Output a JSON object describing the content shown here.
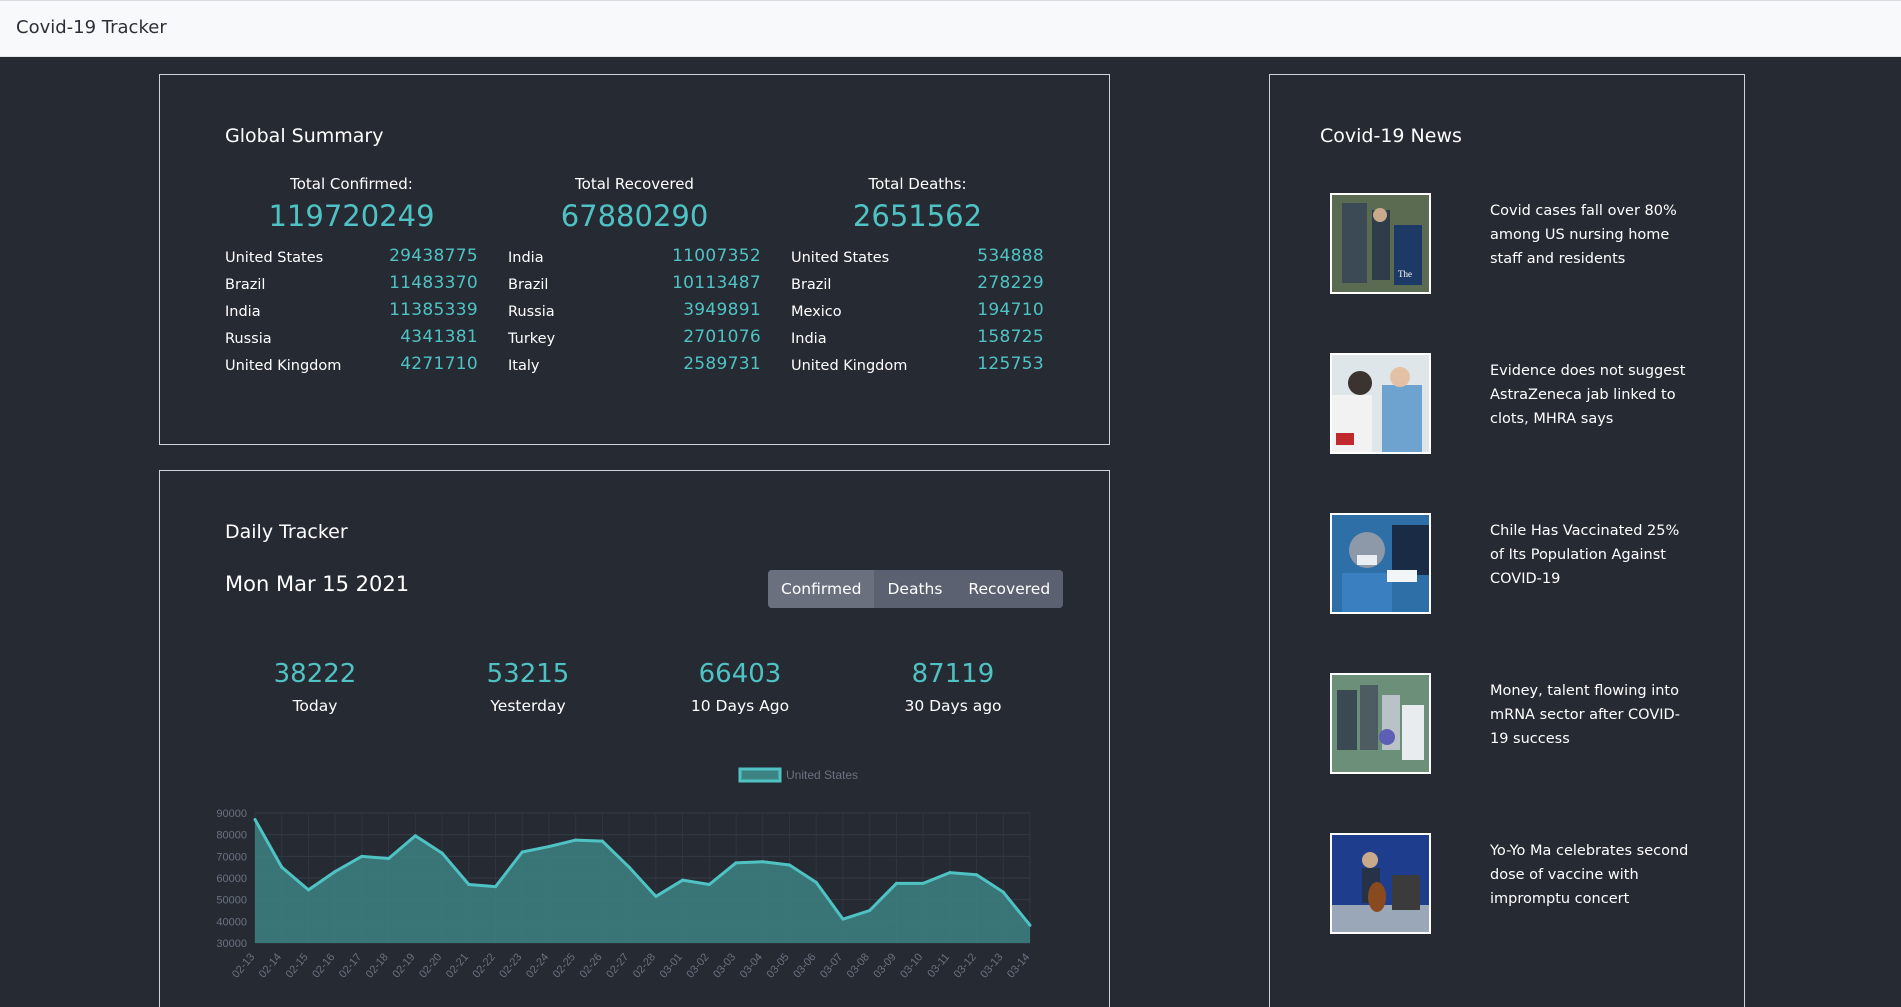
{
  "app": {
    "title": "Covid-19 Tracker"
  },
  "summary": {
    "title": "Global Summary",
    "columns": [
      {
        "heading": "Total Confirmed:",
        "total": "119720249",
        "rows": [
          {
            "name": "United States",
            "value": "29438775"
          },
          {
            "name": "Brazil",
            "value": "11483370"
          },
          {
            "name": "India",
            "value": "11385339"
          },
          {
            "name": "Russia",
            "value": "4341381"
          },
          {
            "name": "United Kingdom",
            "value": "4271710"
          }
        ]
      },
      {
        "heading": "Total Recovered",
        "total": "67880290",
        "rows": [
          {
            "name": "India",
            "value": "11007352"
          },
          {
            "name": "Brazil",
            "value": "10113487"
          },
          {
            "name": "Russia",
            "value": "3949891"
          },
          {
            "name": "Turkey",
            "value": "2701076"
          },
          {
            "name": "Italy",
            "value": "2589731"
          }
        ]
      },
      {
        "heading": "Total Deaths:",
        "total": "2651562",
        "rows": [
          {
            "name": "United States",
            "value": "534888"
          },
          {
            "name": "Brazil",
            "value": "278229"
          },
          {
            "name": "Mexico",
            "value": "194710"
          },
          {
            "name": "India",
            "value": "158725"
          },
          {
            "name": "United Kingdom",
            "value": "125753"
          }
        ]
      }
    ]
  },
  "daily": {
    "title": "Daily Tracker",
    "date": "Mon Mar 15 2021",
    "buttons": [
      "Confirmed",
      "Deaths",
      "Recovered"
    ],
    "active_button": "Confirmed",
    "stats": [
      {
        "value": "38222",
        "label": "Today"
      },
      {
        "value": "53215",
        "label": "Yesterday"
      },
      {
        "value": "66403",
        "label": "10 Days Ago"
      },
      {
        "value": "87119",
        "label": "30 Days ago"
      }
    ]
  },
  "chart_data": {
    "type": "area",
    "legend": "United States",
    "line_color": "#4fc3c3",
    "fill_color": "#3d8383",
    "x": [
      "02-13",
      "02-14",
      "02-15",
      "02-16",
      "02-17",
      "02-18",
      "02-19",
      "02-20",
      "02-21",
      "02-22",
      "02-23",
      "02-24",
      "02-25",
      "02-26",
      "02-27",
      "02-28",
      "03-01",
      "03-02",
      "03-03",
      "03-04",
      "03-05",
      "03-06",
      "03-07",
      "03-08",
      "03-09",
      "03-10",
      "03-11",
      "03-12",
      "03-13",
      "03-14"
    ],
    "values": [
      87000,
      65000,
      54500,
      63000,
      70000,
      69000,
      79500,
      71500,
      57000,
      56000,
      72000,
      74500,
      77500,
      77000,
      65000,
      51500,
      59000,
      57000,
      67000,
      67500,
      66000,
      58000,
      41000,
      45000,
      57500,
      57500,
      62500,
      61500,
      53500,
      38200
    ],
    "ylim": [
      30000,
      90000
    ],
    "yticks": [
      90000,
      80000,
      70000,
      60000,
      50000,
      40000,
      30000
    ]
  },
  "news": {
    "title": "Covid-19 News",
    "items": [
      {
        "headline": "Covid cases fall over 80% among US nursing home staff and residents",
        "thumb": "nursing-home-photo"
      },
      {
        "headline": "Evidence does not suggest AstraZeneca jab linked to clots, MHRA says",
        "thumb": "vaccination-photo"
      },
      {
        "headline": "Chile Has Vaccinated 25% of Its Population Against COVID-19",
        "thumb": "nurse-injection-photo"
      },
      {
        "headline": "Money, talent flowing into mRNA sector after COVID-19 success",
        "thumb": "lab-photo"
      },
      {
        "headline": "Yo-Yo Ma celebrates second dose of vaccine with impromptu concert",
        "thumb": "cello-concert-photo"
      }
    ]
  }
}
